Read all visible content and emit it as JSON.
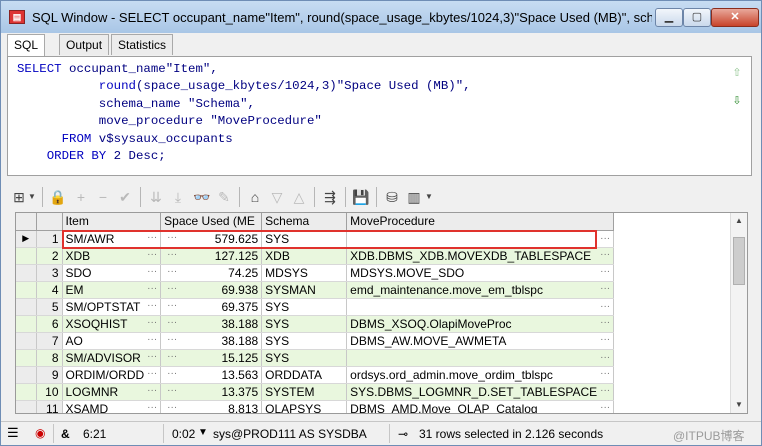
{
  "window": {
    "title": "SQL Window - SELECT occupant_name\"Item\", round(space_usage_kbytes/1024,3)\"Space Used (MB)\", sch...",
    "controls": {
      "minimize": "▭",
      "maximize": "▭",
      "close": "✕"
    }
  },
  "tabs": [
    "SQL",
    "Output",
    "Statistics"
  ],
  "sql": {
    "lines": [
      {
        "indent": "",
        "kw": "SELECT",
        "rest": " occupant_name\"Item\","
      },
      {
        "indent": "           ",
        "kw": "round",
        "rest": "(space_usage_kbytes/1024,3)\"Space Used (MB)\","
      },
      {
        "indent": "           ",
        "kw": "",
        "rest": "schema_name \"Schema\","
      },
      {
        "indent": "           ",
        "kw": "",
        "rest": "move_procedure \"MoveProcedure\""
      },
      {
        "indent": "      ",
        "kw": "FROM",
        "rest": " v$sysaux_occupants"
      },
      {
        "indent": "    ",
        "kw": "ORDER BY",
        "rest": " 2 Desc;"
      }
    ]
  },
  "grid": {
    "columns": [
      "Item",
      "Space Used (ME",
      "Schema",
      "MoveProcedure"
    ],
    "rows": [
      {
        "n": "1",
        "item": "SM/AWR",
        "space": "579.625",
        "schema": "SYS",
        "proc": ""
      },
      {
        "n": "2",
        "item": "XDB",
        "space": "127.125",
        "schema": "XDB",
        "proc": "XDB.DBMS_XDB.MOVEXDB_TABLESPACE"
      },
      {
        "n": "3",
        "item": "SDO",
        "space": "74.25",
        "schema": "MDSYS",
        "proc": "MDSYS.MOVE_SDO"
      },
      {
        "n": "4",
        "item": "EM",
        "space": "69.938",
        "schema": "SYSMAN",
        "proc": "emd_maintenance.move_em_tblspc"
      },
      {
        "n": "5",
        "item": "SM/OPTSTAT",
        "space": "69.375",
        "schema": "SYS",
        "proc": ""
      },
      {
        "n": "6",
        "item": "XSOQHIST",
        "space": "38.188",
        "schema": "SYS",
        "proc": "DBMS_XSOQ.OlapiMoveProc"
      },
      {
        "n": "7",
        "item": "AO",
        "space": "38.188",
        "schema": "SYS",
        "proc": "DBMS_AW.MOVE_AWMETA"
      },
      {
        "n": "8",
        "item": "SM/ADVISOR",
        "space": "15.125",
        "schema": "SYS",
        "proc": ""
      },
      {
        "n": "9",
        "item": "ORDIM/ORDD",
        "space": "13.563",
        "schema": "ORDDATA",
        "proc": "ordsys.ord_admin.move_ordim_tblspc"
      },
      {
        "n": "10",
        "item": "LOGMNR",
        "space": "13.375",
        "schema": "SYSTEM",
        "proc": "SYS.DBMS_LOGMNR_D.SET_TABLESPACE"
      },
      {
        "n": "11",
        "item": "XSAMD",
        "space": "8.813",
        "schema": "OLAPSYS",
        "proc": "DBMS_AMD.Move_OLAP_Catalog"
      }
    ]
  },
  "status": {
    "cursor": "6:21",
    "elapsed": "0:02",
    "connection": "sys@PROD111 AS SYSDBA",
    "message": "31 rows selected in 2.126 seconds",
    "watermark": "@ITPUB博客"
  },
  "colors": {
    "highlight_border": "#e0322d",
    "alt_row": "#e9f7de"
  }
}
